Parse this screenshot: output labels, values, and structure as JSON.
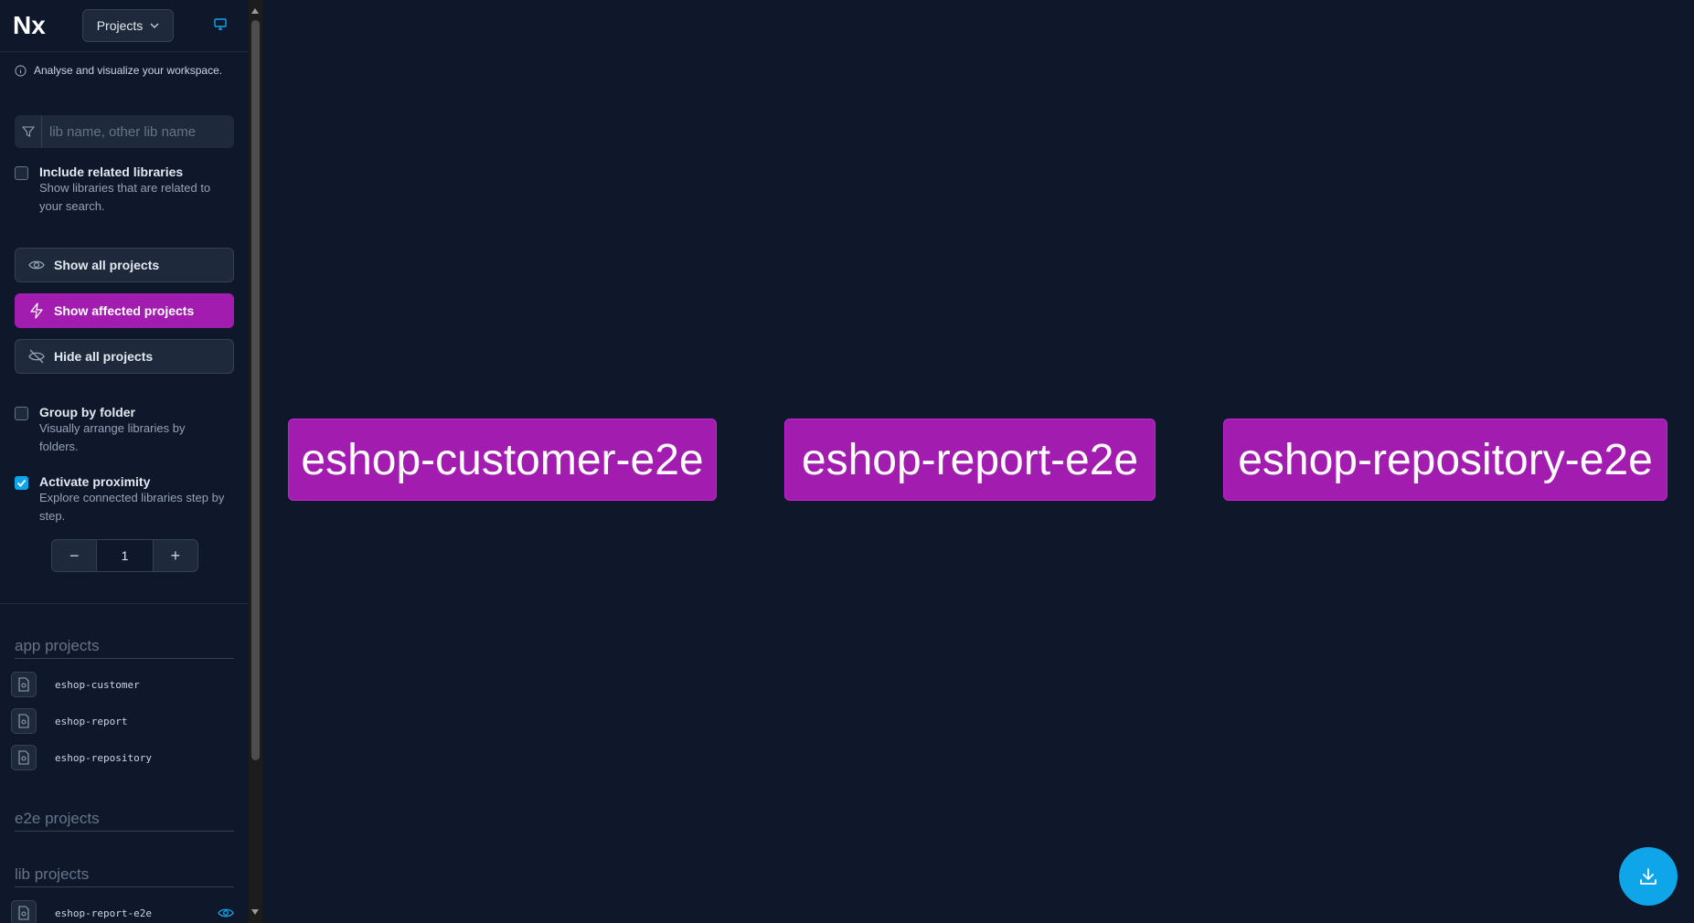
{
  "header": {
    "logo": "Nx",
    "view_selector": "Projects"
  },
  "info_text": "Analyse and visualize your workspace.",
  "search": {
    "placeholder": "lib name, other lib name",
    "value": ""
  },
  "include_related": {
    "title": "Include related libraries",
    "description": "Show libraries that are related to your search.",
    "checked": false
  },
  "buttons": {
    "show_all": "Show all projects",
    "show_affected": "Show affected projects",
    "hide_all": "Hide all projects"
  },
  "group_by_folder": {
    "title": "Group by folder",
    "description": "Visually arrange libraries by folders.",
    "checked": false
  },
  "activate_proximity": {
    "title": "Activate proximity",
    "description": "Explore connected libraries step by step.",
    "checked": true
  },
  "stepper": {
    "minus": "−",
    "value": "1",
    "plus": "+"
  },
  "project_groups": [
    {
      "title": "app projects",
      "items": [
        "eshop-customer",
        "eshop-report",
        "eshop-repository"
      ]
    },
    {
      "title": "e2e projects",
      "items": []
    },
    {
      "title": "lib projects",
      "items": [
        "eshop-report-e2e"
      ]
    }
  ],
  "graph_nodes": [
    "eshop-customer-e2e",
    "eshop-report-e2e",
    "eshop-repository-e2e"
  ],
  "colors": {
    "accent": "#a21caf",
    "background": "#0f172a",
    "download": "#0ea5e9"
  },
  "icons": [
    "nx-logo",
    "chevron-down-icon",
    "monitor-icon",
    "info-icon",
    "filter-icon",
    "eye-icon",
    "bolt-icon",
    "eye-off-icon",
    "file-icon",
    "download-icon"
  ]
}
